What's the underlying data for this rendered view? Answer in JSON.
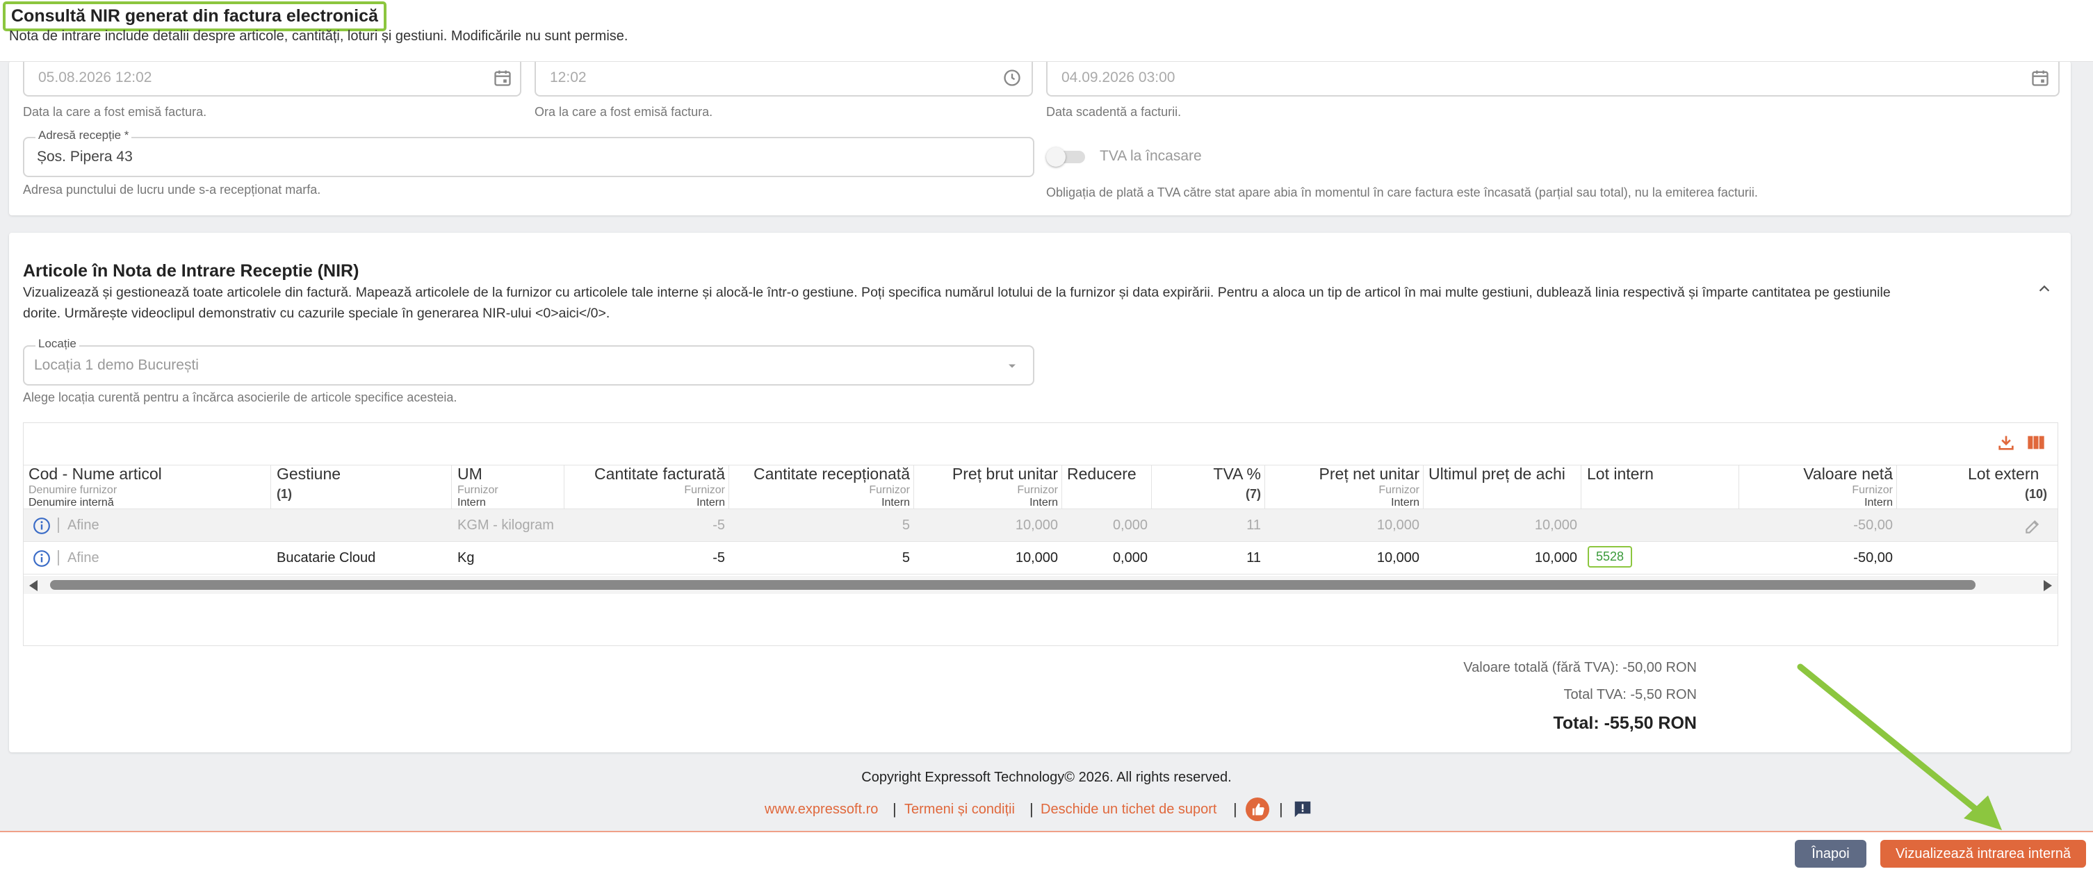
{
  "header": {
    "title": "Consultă NIR generat din factura electronică",
    "subtitle": "Nota de intrare include detalii despre articole, cantități, loturi și gestiuni. Modificările nu sunt permise."
  },
  "invoice": {
    "date_value": "05.08.2026 12:02",
    "date_helper": "Data la care a fost emisă factura.",
    "time_value": "12:02",
    "time_helper": "Ora la care a fost emisă factura.",
    "due_value": "04.09.2026 03:00",
    "due_helper": "Data scadentă a facturii.",
    "address_label": "Adresă recepție *",
    "address_value": "Șos. Pipera 43",
    "address_helper": "Adresa punctului de lucru unde s-a recepționat marfa.",
    "vat_toggle_label": "TVA la încasare",
    "vat_toggle_on": false,
    "vat_helper": "Obligația de plată a TVA către stat apare abia în momentul în care factura este încasată (parțial sau total), nu la emiterea facturii."
  },
  "articles": {
    "title": "Articole în Nota de Intrare Receptie (NIR)",
    "description_line1": "Vizualizează și gestionează toate articolele din factură. Mapează articolele de la furnizor cu articolele tale interne și alocă-le într-o gestiune. Poți specifica numărul lotului de la furnizor și data expirării. Pentru a aloca un tip de articol în mai multe gestiuni, dublează linia respectivă și împarte cantitatea pe gestiunile",
    "description_line2": "dorite. Urmărește videoclipul demonstrativ cu cazurile speciale în generarea NIR-ului <0>aici</0>.",
    "location_label": "Locație",
    "location_value": "Locația 1 demo București",
    "location_helper": "Alege locația curentă pentru a încărca asocierile de articole specifice acesteia."
  },
  "table": {
    "headers": {
      "code": "Cod - Nume articol",
      "code_sub1": "Denumire furnizor",
      "code_sub2": "Denumire internă",
      "gestiune": "Gestiune",
      "gestiune_count": "(1)",
      "um": "UM",
      "um_sub1": "Furnizor",
      "um_sub2": "Intern",
      "qty_inv": "Cantitate facturată",
      "qty_inv_sub1": "Furnizor",
      "qty_inv_sub2": "Intern",
      "qty_rec": "Cantitate recepționată",
      "qty_rec_sub1": "Furnizor",
      "qty_rec_sub2": "Intern",
      "gross": "Preț brut unitar",
      "gross_sub1": "Furnizor",
      "gross_sub2": "Intern",
      "discount": "Reducere",
      "vat": "TVA %",
      "vat_count": "(7)",
      "net": "Preț net unitar",
      "net_sub1": "Furnizor",
      "net_sub2": "Intern",
      "last_price": "Ultimul preț de achi",
      "lot_int": "Lot intern",
      "net_value": "Valoare netă",
      "net_value_sub1": "Furnizor",
      "net_value_sub2": "Intern",
      "lot_ext": "Lot extern",
      "lot_ext_count": "(10)"
    },
    "rows": [
      {
        "name": "Afine",
        "gestiune": "",
        "um": "KGM - kilogram",
        "qty_inv": "-5",
        "qty_rec": "5",
        "gross": "10,000",
        "discount": "0,000",
        "vat": "11",
        "net": "10,000",
        "last_price": "10,000",
        "lot_int": "",
        "net_value": "-50,00"
      },
      {
        "name": "Afine",
        "gestiune": "Bucatarie Cloud",
        "um": "Kg",
        "qty_inv": "-5",
        "qty_rec": "5",
        "gross": "10,000",
        "discount": "0,000",
        "vat": "11",
        "net": "10,000",
        "last_price": "10,000",
        "lot_int": "5528",
        "net_value": "-50,00"
      }
    ]
  },
  "totals": {
    "net_total": "Valoare totală (fără TVA): -50,00 RON",
    "vat_total": "Total TVA: -5,50 RON",
    "grand_total": "Total: -55,50 RON"
  },
  "footer": {
    "copyright": "Copyright Expressoft Technology© 2026. All rights reserved.",
    "link_site": "www.expressoft.ro",
    "link_terms": "Termeni și condiții",
    "link_ticket": "Deschide un tichet de suport",
    "separator": "|"
  },
  "actions": {
    "back_label": "Înapoi",
    "view_label": "Vizualizează intrarea internă"
  },
  "colors": {
    "accent": "#e0683c",
    "back_button": "#5f6b85",
    "highlight": "#8cc63f",
    "info_icon": "#3b6cc7"
  }
}
